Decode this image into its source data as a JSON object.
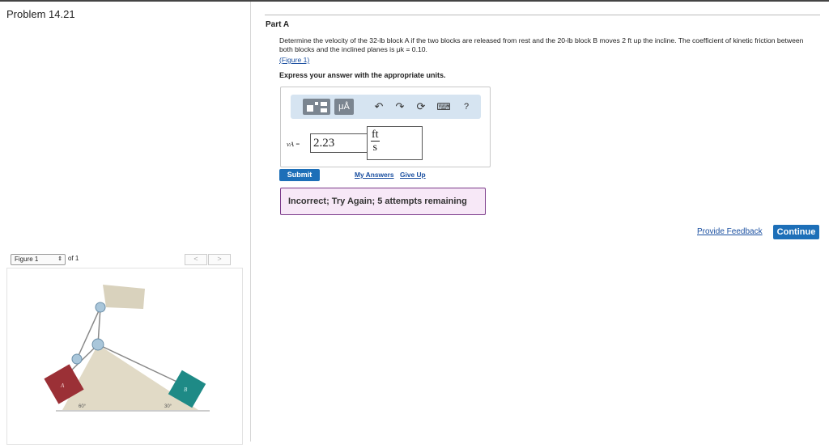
{
  "problem": {
    "title": "Problem 14.21"
  },
  "figure_nav": {
    "selected": "Figure 1",
    "of_label": "of 1",
    "prev": "<",
    "next": ">"
  },
  "figure": {
    "block_a": "A",
    "block_b": "B",
    "angle_left": "60°",
    "angle_right": "30°",
    "colors": {
      "block_a": "#9b3036",
      "block_b": "#1e8a86",
      "incline": "#d9d2bd"
    }
  },
  "part": {
    "label": "Part A",
    "question": "Determine the velocity of the 32-lb block A if the two blocks are released from rest and the 20-lb block B moves 2 ft up the incline. The coefficient of kinetic friction between both blocks and the inclined planes is μk = 0.10.",
    "figure_link": "(Figure 1)",
    "instruction": "Express your answer with the appropriate units."
  },
  "toolbar": {
    "mu_label": "μÅ",
    "undo": "↶",
    "redo": "↷",
    "reset": "⟳",
    "keyboard": "⌨",
    "help": "?"
  },
  "answer": {
    "variable": "vA =",
    "value": "2.23",
    "unit_num": "ft",
    "unit_den": "s"
  },
  "actions": {
    "submit": "Submit",
    "my_answers": "My Answers",
    "give_up": "Give Up"
  },
  "feedback_msg": "Incorrect; Try Again; 5 attempts remaining",
  "footer": {
    "provide_feedback": "Provide Feedback",
    "continue": "Continue"
  }
}
